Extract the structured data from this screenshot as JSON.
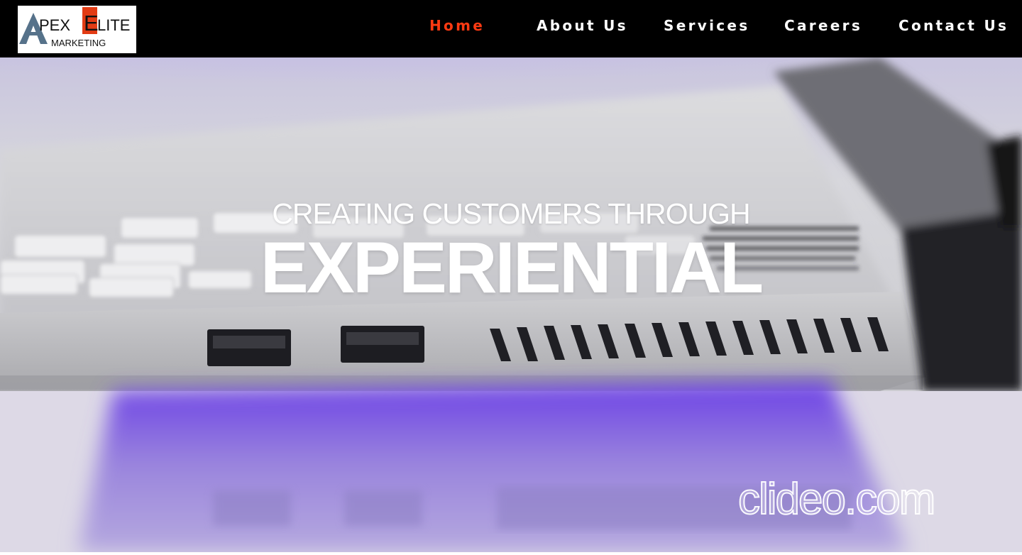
{
  "logo": {
    "line1_apex": "PEX",
    "line1_e": "E",
    "line1_lite": "LITE",
    "line2": "MARKETING"
  },
  "nav": {
    "items": [
      {
        "label": "Home",
        "active": true
      },
      {
        "label": "About Us",
        "active": false
      },
      {
        "label": "Services",
        "active": false
      },
      {
        "label": "Careers",
        "active": false
      },
      {
        "label": "Contact Us",
        "active": false
      }
    ]
  },
  "hero": {
    "line1": "CREATING CUSTOMERS THROUGH",
    "line2": "EXPERIENTIAL",
    "watermark": "clideo.com"
  },
  "colors": {
    "header_bg": "#000000",
    "nav_text": "#ffffff",
    "nav_active": "#ff3a12",
    "logo_red": "#e23b14",
    "logo_slate": "#56728a",
    "hero_glow": "#7b4fe0"
  }
}
